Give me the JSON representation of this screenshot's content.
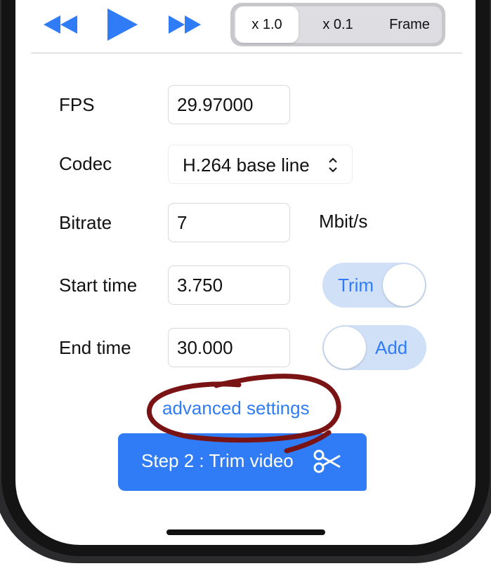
{
  "transport": {
    "rewind_icon": "rewind-icon",
    "play_icon": "play-icon",
    "fast_forward_icon": "fast-forward-icon"
  },
  "speed_selector": {
    "options": [
      "x 1.0",
      "x 0.1",
      "Frame"
    ],
    "selected": "x 1.0"
  },
  "form": {
    "fps": {
      "label": "FPS",
      "value": "29.97000"
    },
    "codec": {
      "label": "Codec",
      "value": "H.264 base line",
      "icon": "chevron-up-down-icon"
    },
    "bitrate": {
      "label": "Bitrate",
      "value": "7",
      "unit": "Mbit/s"
    },
    "start_time": {
      "label": "Start time",
      "value": "3.750",
      "toggle_label": "Trim",
      "toggle_on": true
    },
    "end_time": {
      "label": "End time",
      "value": "30.000",
      "toggle_label": "Add",
      "toggle_on": false
    }
  },
  "advanced_link": "advanced settings",
  "primary_button": {
    "label": "Step 2 : Trim video",
    "icon": "scissors-icon"
  },
  "colors": {
    "accent": "#2f7cf6",
    "toggle_bg": "#cfe0f7",
    "annotation": "#7a1414"
  }
}
